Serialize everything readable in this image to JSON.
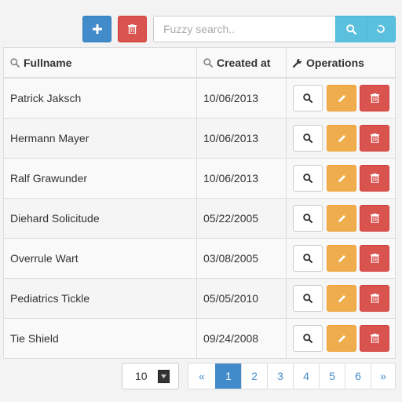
{
  "toolbar": {
    "add_icon": "plus-icon",
    "delete_icon": "trash-icon",
    "search_placeholder": "Fuzzy search..",
    "search_value": "",
    "search_icon": "search-icon",
    "reset_icon": "refresh-icon"
  },
  "table": {
    "headers": {
      "fullname": "Fullname",
      "created_at": "Created at",
      "operations": "Operations"
    },
    "rows": [
      {
        "fullname": "Patrick Jaksch",
        "created_at": "10/06/2013"
      },
      {
        "fullname": "Hermann Mayer",
        "created_at": "10/06/2013"
      },
      {
        "fullname": "Ralf Grawunder",
        "created_at": "10/06/2013"
      },
      {
        "fullname": "Diehard Solicitude",
        "created_at": "05/22/2005"
      },
      {
        "fullname": "Overrule Wart",
        "created_at": "03/08/2005"
      },
      {
        "fullname": "Pediatrics Tickle",
        "created_at": "05/05/2010"
      },
      {
        "fullname": "Tie Shield",
        "created_at": "09/24/2008"
      }
    ],
    "row_actions": [
      "view",
      "edit",
      "delete"
    ]
  },
  "pagination": {
    "page_size": "10",
    "prev": "«",
    "next": "»",
    "pages": [
      "1",
      "2",
      "3",
      "4",
      "5",
      "6"
    ],
    "current_page": "1"
  },
  "colors": {
    "primary": "#428bca",
    "danger": "#d9534f",
    "warning": "#f0ad4e",
    "info": "#5bc0de"
  }
}
